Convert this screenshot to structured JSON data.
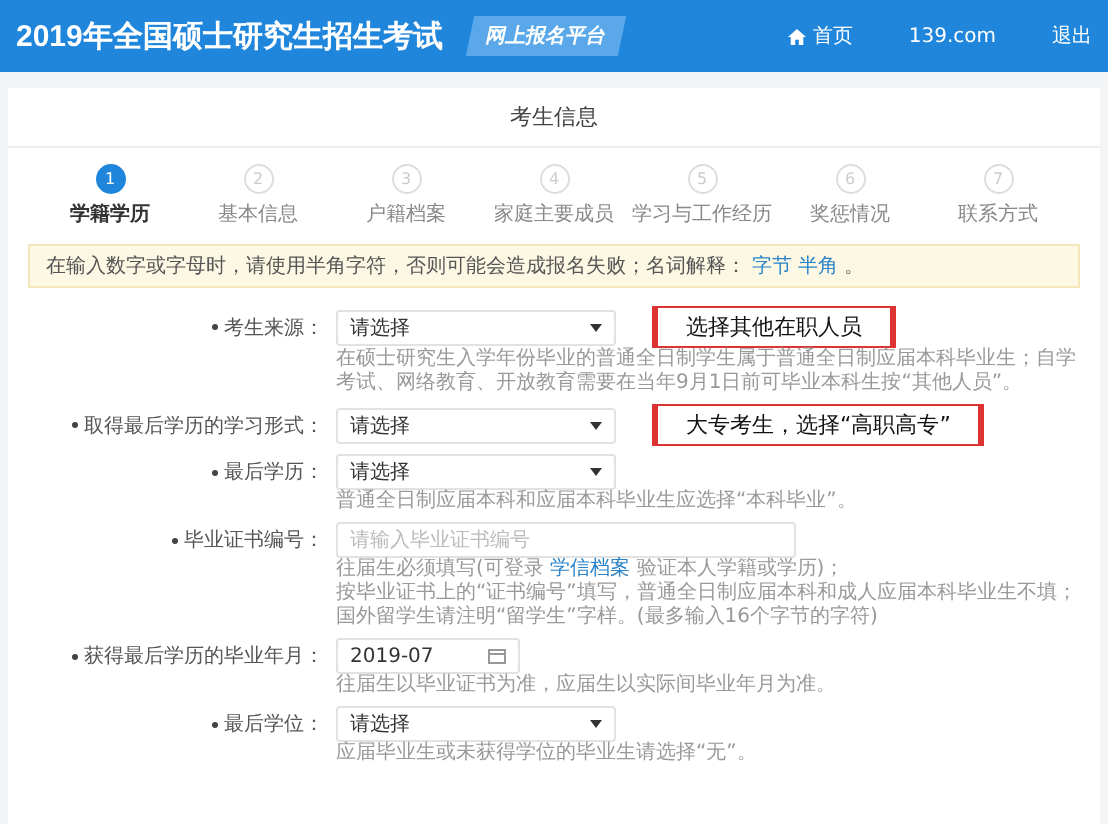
{
  "header": {
    "title": "2019年全国硕士研究生招生考试",
    "badge": "网上报名平台",
    "nav": [
      {
        "kind": "home",
        "label": "首页"
      },
      {
        "kind": "user",
        "label": "139.com"
      },
      {
        "kind": "link",
        "label": "退出"
      }
    ]
  },
  "card": {
    "title": "考生信息"
  },
  "steps": [
    {
      "number": "1",
      "label": "学籍学历",
      "selected": true
    },
    {
      "number": "2",
      "label": "基本信息",
      "selected": false
    },
    {
      "number": "3",
      "label": "户籍档案",
      "selected": false
    },
    {
      "number": "4",
      "label": "家庭主要成员",
      "selected": false
    },
    {
      "number": "5",
      "label": "学习与工作经历",
      "selected": false
    },
    {
      "number": "6",
      "label": "奖惩情况",
      "selected": false
    },
    {
      "number": "7",
      "label": "联系方式",
      "selected": false
    }
  ],
  "notice": {
    "text": "在输入数字或字母时，请使用半角字符，否则可能会造成报名失败；名词解释：",
    "links": [
      "字节",
      "半角"
    ],
    "end": "。"
  },
  "fields": [
    {
      "kind": "select",
      "label": "考生来源：",
      "required": true,
      "value": "请选择",
      "hints": [
        {
          "text": "在硕士研究生入学年份毕业的普通全日制学生属于普通全日制应届本科毕业生；自学考试、网络教育、开放教育需要在当年9月1日前可毕业本科生按“其他人员”。"
        }
      ],
      "annotation": "选择其他在职人员"
    },
    {
      "kind": "select",
      "label": "取得最后学历的学习形式：",
      "required": true,
      "value": "请选择",
      "annotation": "大专考生，选择“高职高专”"
    },
    {
      "kind": "select",
      "label": "最后学历：",
      "required": true,
      "value": "请选择",
      "hints": [
        {
          "text": "普通全日制应届本科和应届本科毕业生应选择“本科毕业”。"
        }
      ]
    },
    {
      "kind": "input",
      "label": "毕业证书编号：",
      "required": true,
      "placeholder": "请输入毕业证书编号",
      "hints": [
        {
          "before": "往届生必须填写(可登录 ",
          "link": "学信档案",
          "after": " 验证本人学籍或学历)；"
        },
        {
          "text": "按毕业证书上的“证书编号”填写，普通全日制应届本科和成人应届本科毕业生不填；国外留学生请注明“留学生”字样。(最多输入16个字节的字符)"
        }
      ]
    },
    {
      "kind": "date",
      "label": "获得最后学历的毕业年月：",
      "required": true,
      "value": "2019-07",
      "hints": [
        {
          "text": "往届生以毕业证书为准，应届生以实际间毕业年月为准。"
        }
      ]
    },
    {
      "kind": "select",
      "label": "最后学位：",
      "required": true,
      "value": "请选择",
      "hints": [
        {
          "text": "应届毕业生或未获得学位的毕业生请选择“无”。"
        }
      ]
    }
  ]
}
